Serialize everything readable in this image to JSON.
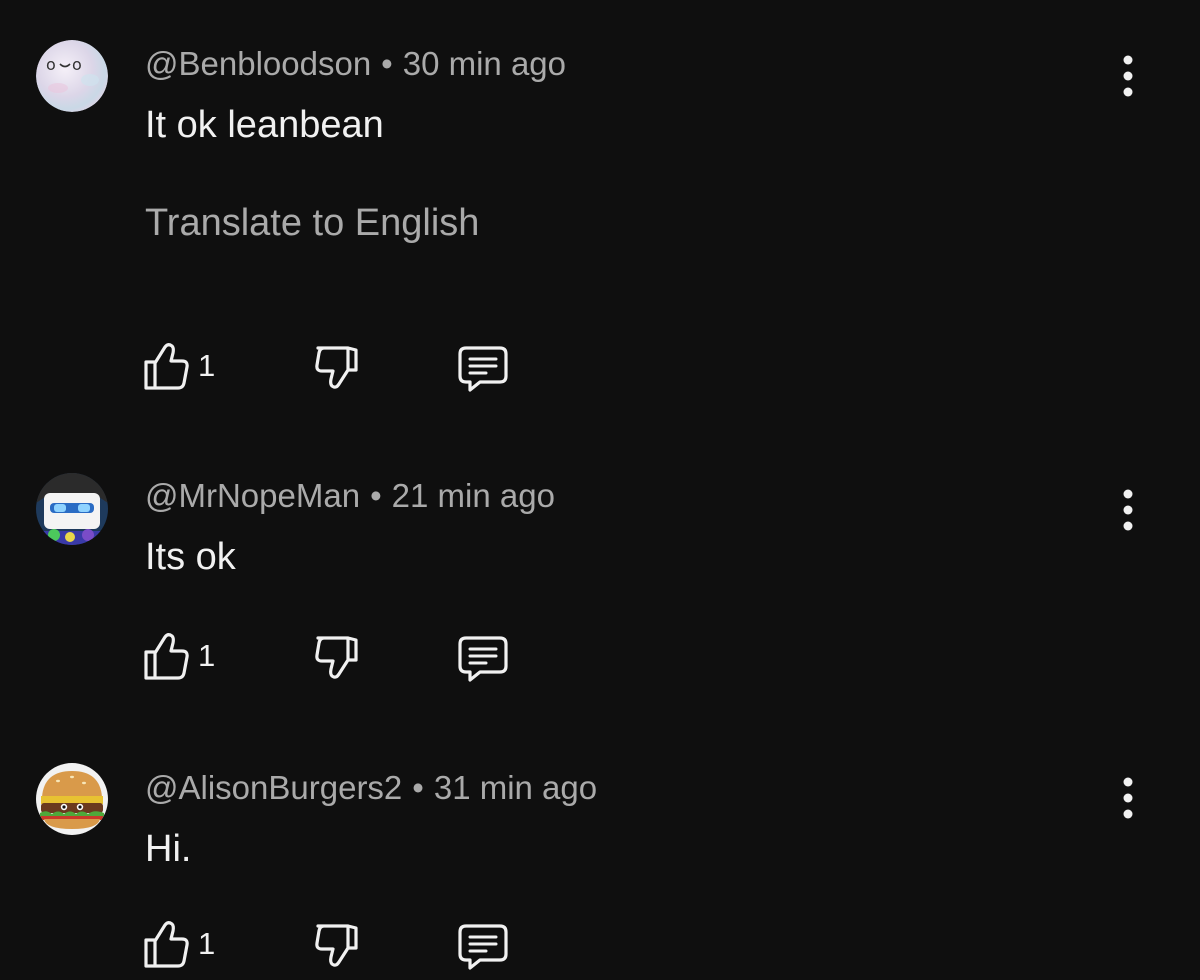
{
  "comments": [
    {
      "author": "@Benbloodson",
      "separator": "•",
      "time": "30 min ago",
      "text": "It ok leanbean",
      "translate_label": "Translate to English",
      "like_count": "1",
      "avatar_icon": "pale-bubble-face-avatar"
    },
    {
      "author": "@MrNopeMan",
      "separator": "•",
      "time": "21 min ago",
      "text": "Its ok",
      "like_count": "1",
      "avatar_icon": "blue-white-character-avatar"
    },
    {
      "author": "@AlisonBurgers2",
      "separator": "•",
      "time": "31 min ago",
      "text": "Hi.",
      "like_count": "1",
      "avatar_icon": "burger-character-avatar"
    }
  ],
  "colors": {
    "background": "#0f0f0f",
    "primary_text": "#f1f1f1",
    "secondary_text": "#aaaaaa"
  }
}
